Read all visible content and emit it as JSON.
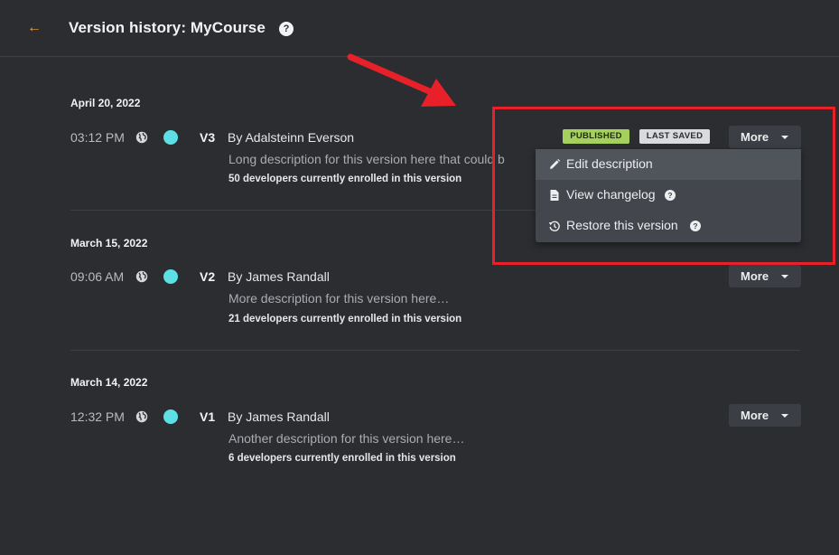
{
  "header": {
    "title": "Version history: MyCourse",
    "back_icon": "arrow-left-icon",
    "help_glyph": "?"
  },
  "versions": [
    {
      "date": "April 20, 2022",
      "time": "03:12 PM",
      "version": "V3",
      "author": "By Adalsteinn Everson",
      "description": "Long description for this version here that could b",
      "enrolled": "50 developers currently enrolled in this version",
      "badges": [
        "PUBLISHED",
        "LAST SAVED"
      ],
      "more_label": "More"
    },
    {
      "date": "March 15, 2022",
      "time": "09:06 AM",
      "version": "V2",
      "author": "By James Randall",
      "description": "More description for this version here…",
      "enrolled": "21 developers currently enrolled in this version",
      "more_label": "More"
    },
    {
      "date": "March 14, 2022",
      "time": "12:32 PM",
      "version": "V1",
      "author": "By James Randall",
      "description": "Another description for this version here…",
      "enrolled": "6 developers currently enrolled in this version",
      "more_label": "More"
    }
  ],
  "dropdown": {
    "items": [
      {
        "label": "Edit description",
        "icon": "pencil-icon",
        "active": true
      },
      {
        "label": "View changelog",
        "icon": "document-icon",
        "help": true
      },
      {
        "label": "Restore this version",
        "icon": "history-icon",
        "help": true
      }
    ]
  },
  "colors": {
    "background": "#2b2d31",
    "accent_back": "#f0a13a",
    "status_dot": "#5ce0e6",
    "badge_published": "#a6d05d",
    "badge_saved": "#d9dbde",
    "annotation": "#e8202a"
  }
}
